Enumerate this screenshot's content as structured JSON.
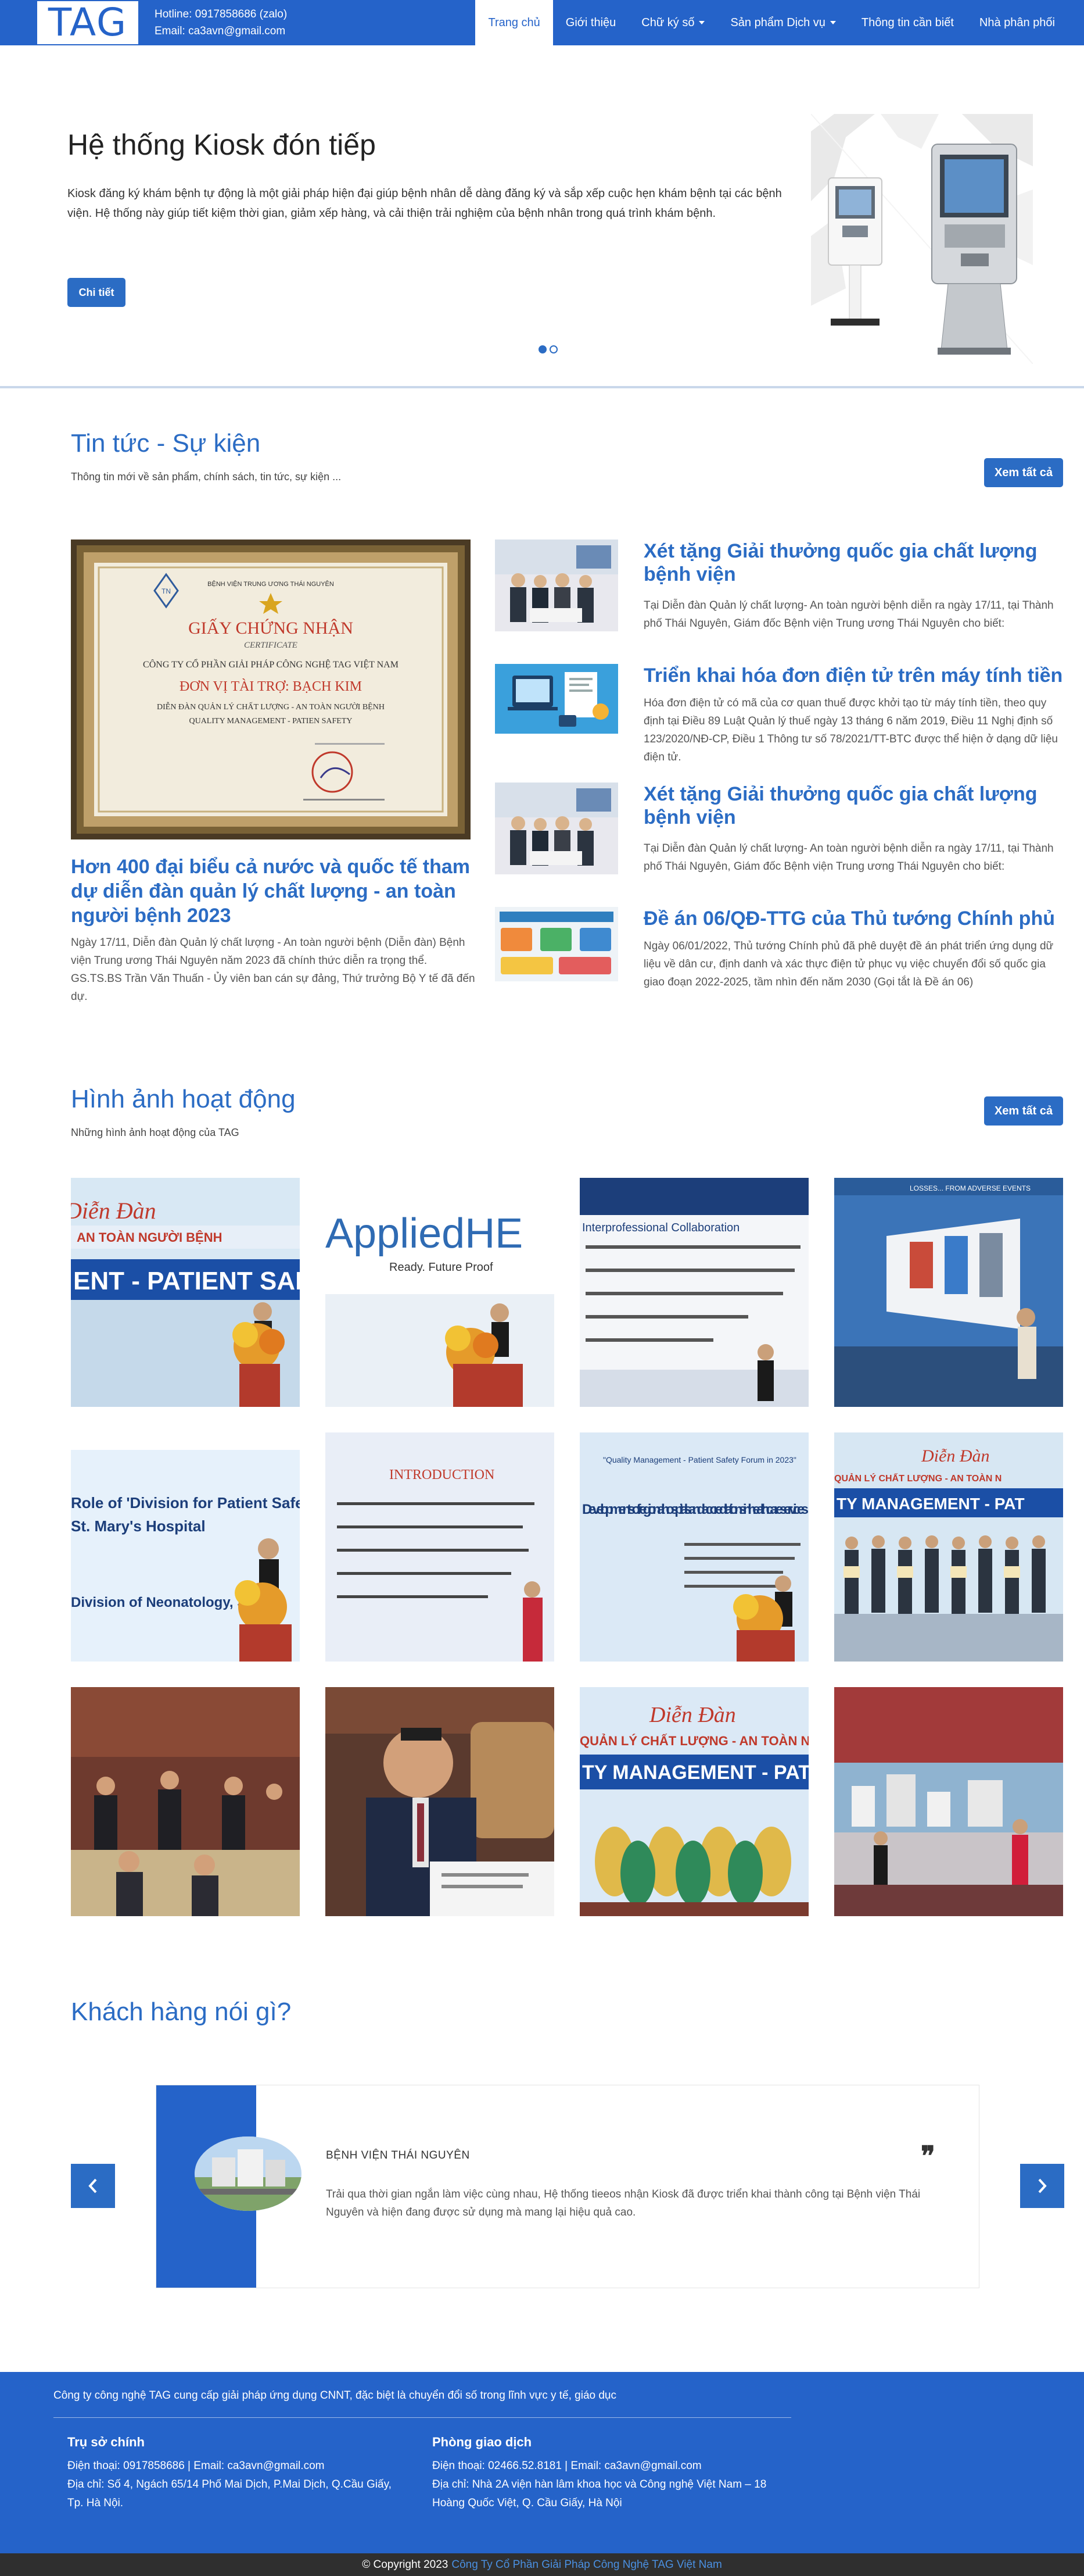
{
  "header": {
    "logo": "TAG",
    "hotline": "Hotline: 0917858686 (zalo)",
    "email": "Email: ca3avn@gmail.com",
    "nav": [
      {
        "label": "Trang chủ",
        "active": true
      },
      {
        "label": "Giới thiệu",
        "active": false
      },
      {
        "label": "Chữ ký số",
        "dropdown": true
      },
      {
        "label": "Sản phẩm Dịch vụ",
        "dropdown": true
      },
      {
        "label": "Thông tin cần biết",
        "active": false
      },
      {
        "label": "Nhà phân phối",
        "active": false
      }
    ]
  },
  "hero": {
    "title": "Hệ thống Kiosk đón tiếp",
    "description": "Kiosk đăng ký khám bệnh tự động là một giải pháp hiện đại giúp bệnh nhân dễ dàng đăng ký và sắp xếp cuộc hẹn khám bệnh tại các bệnh viện. Hệ thống này giúp tiết kiệm thời gian, giảm xếp hàng, và cải thiện trải nghiệm của bệnh nhân trong quá trình khám bệnh.",
    "button": "Chi tiết",
    "slides_total": 2,
    "slide_active": 1
  },
  "news": {
    "title": "Tin tức - Sự kiện",
    "subtitle": "Thông tin mới về sản phẩm, chính sách, tin tức, sự kiện ...",
    "see_all": "Xem tất cả",
    "certificate": {
      "org": "BỆNH VIỆN TRUNG ƯƠNG THÁI NGUYÊN",
      "heading": "GIẤY CHỨNG NHẬN",
      "heading_en": "CERTIFICATE",
      "company": "CÔNG TY CỔ PHẦN GIẢI PHÁP CÔNG NGHỆ TAG VIỆT NAM",
      "sponsor": "ĐƠN VỊ TÀI TRỢ: BẠCH KIM",
      "forum": "DIỄN ĐÀN QUẢN LÝ CHẤT LƯỢNG - AN TOÀN NGƯỜI BỆNH",
      "forum_en": "QUALITY MANAGEMENT - PATIEN SAFETY"
    },
    "featured": {
      "title": "Hơn 400 đại biểu cả nước và quốc tế tham dự diễn đàn quản lý chất lượng - an toàn người bệnh 2023",
      "description": "Ngày 17/11, Diễn đàn Quản lý chất lượng - An toàn người bệnh (Diễn đàn) Bệnh viện Trung ương Thái Nguyên năm 2023 đã chính thức diễn ra trọng thể. GS.TS.BS Trần Văn Thuấn - Ủy viên ban cán sự đảng, Thứ trưởng Bộ Y tế đã đến dự."
    },
    "items": [
      {
        "title": "Xét tặng Giải thưởng quốc gia chất lượng bệnh viện",
        "description": "Tại Diễn đàn Quản lý chất lượng- An toàn người bệnh diễn ra ngày 17/11, tại Thành phố Thái Nguyên, Giám đốc Bệnh viện Trung ương Thái Nguyên cho biết:"
      },
      {
        "title": "Triển khai hóa đơn điện tử trên máy tính tiền",
        "description": "Hóa đơn điện tử có mã của cơ quan thuế được khởi tạo từ máy tính tiền, theo quy định tại Điều 89 Luật Quản lý thuế ngày 13 tháng 6 năm 2019, Điều 11 Nghị định số 123/2020/NĐ-CP, Điều 1 Thông tư số 78/2021/TT-BTC được thể hiện ở dạng dữ liệu điện tử."
      },
      {
        "title": "Xét tặng Giải thưởng quốc gia chất lượng bệnh viện",
        "description": "Tại Diễn đàn Quản lý chất lượng- An toàn người bệnh diễn ra ngày 17/11, tại Thành phố Thái Nguyên, Giám đốc Bệnh viện Trung ương Thái Nguyên cho biết:"
      },
      {
        "title": "Đề án 06/QĐ-TTG của Thủ tướng Chính phủ",
        "description": "Ngày 06/01/2022, Thủ tướng Chính phủ đã phê duyệt đề án phát triển ứng dụng dữ liệu về dân cư, định danh và xác thực điện tử phục vụ việc chuyển đổi số quốc gia giao đoạn 2022-2025, tầm nhìn đến năm 2030 (Gọi tắt là Đề án 06)"
      }
    ]
  },
  "gallery": {
    "title": "Hình ảnh hoạt động",
    "subtitle": "Những hình ảnh hoạt động của TAG",
    "see_all": "Xem tất cả",
    "slide_texts": {
      "banner1": "AN TOÀN NGƯỜI BỆNH",
      "banner2": "ENT - PATIENT SAFETY",
      "applied": "AppliedHE",
      "applied_sub": "Ready. Future Proof",
      "collab": "Interprofessional Collaboration",
      "adverse": "LOSSES... FROM ADVERSE EVENTS",
      "division": "Role of 'Division for Patient Safety'",
      "marys": "St. Mary's Hospital",
      "neonat": "Division of Neonatology, St.",
      "intro": "INTRODUCTION",
      "regional": "Developments of regional hospitals and accreditations in healthcare services",
      "forum_en": "\"Quality Management - Patient Safety Forum in 2023\"",
      "dien_dan": "Diễn Đàn",
      "ql_cl": "QUẢN LÝ CHẤT LƯỢNG - AN TOÀN N",
      "ty_mgmt": "TY MANAGEMENT - PAT"
    }
  },
  "testimonial": {
    "title": "Khách hàng nói gì?",
    "name": "BỆNH VIỆN THÁI NGUYÊN",
    "text": "Trải qua thời gian ngắn làm việc cùng nhau, Hệ thống tieeos nhận Kiosk đã được triển khai thành công tại Bệnh viện Thái Nguyên và hiện đang được sử dụng mà mang lại hiệu quả cao."
  },
  "footer": {
    "intro": "Công ty công nghệ TAG cung cấp giải pháp ứng dụng CNNT, đặc biệt là chuyển đổi số trong lĩnh vực y tế, giáo dục",
    "hq": {
      "title": "Trụ sở chính",
      "phone": "Điện thoại: 0917858686 | Email: ca3avn@gmail.com",
      "address": "Địa chỉ: Số 4, Ngách 65/14 Phố Mai Dịch, P.Mai Dịch, Q.Cầu Giấy, Tp. Hà Nội."
    },
    "office": {
      "title": "Phòng giao dịch",
      "phone": "Điện thoại: 02466.52.8181 | Email: ca3avn@gmail.com",
      "address": "Địa chỉ: Nhà 2A viện hàn lâm khoa học và Công nghệ Việt Nam – 18 Hoàng Quốc Việt, Q. Cầu Giấy, Hà Nội"
    },
    "copyright": "© Copyright 2023",
    "company_link": "Công Ty Cổ Phần Giải Pháp Công Nghệ TAG Việt Nam"
  },
  "colors": {
    "brand": "#2563c9",
    "button": "#2b6cc4",
    "footer_bottom": "#2f2f2f"
  },
  "icons": [
    "chevron-left-icon",
    "chevron-right-icon",
    "quote-icon",
    "caret-down-icon"
  ]
}
